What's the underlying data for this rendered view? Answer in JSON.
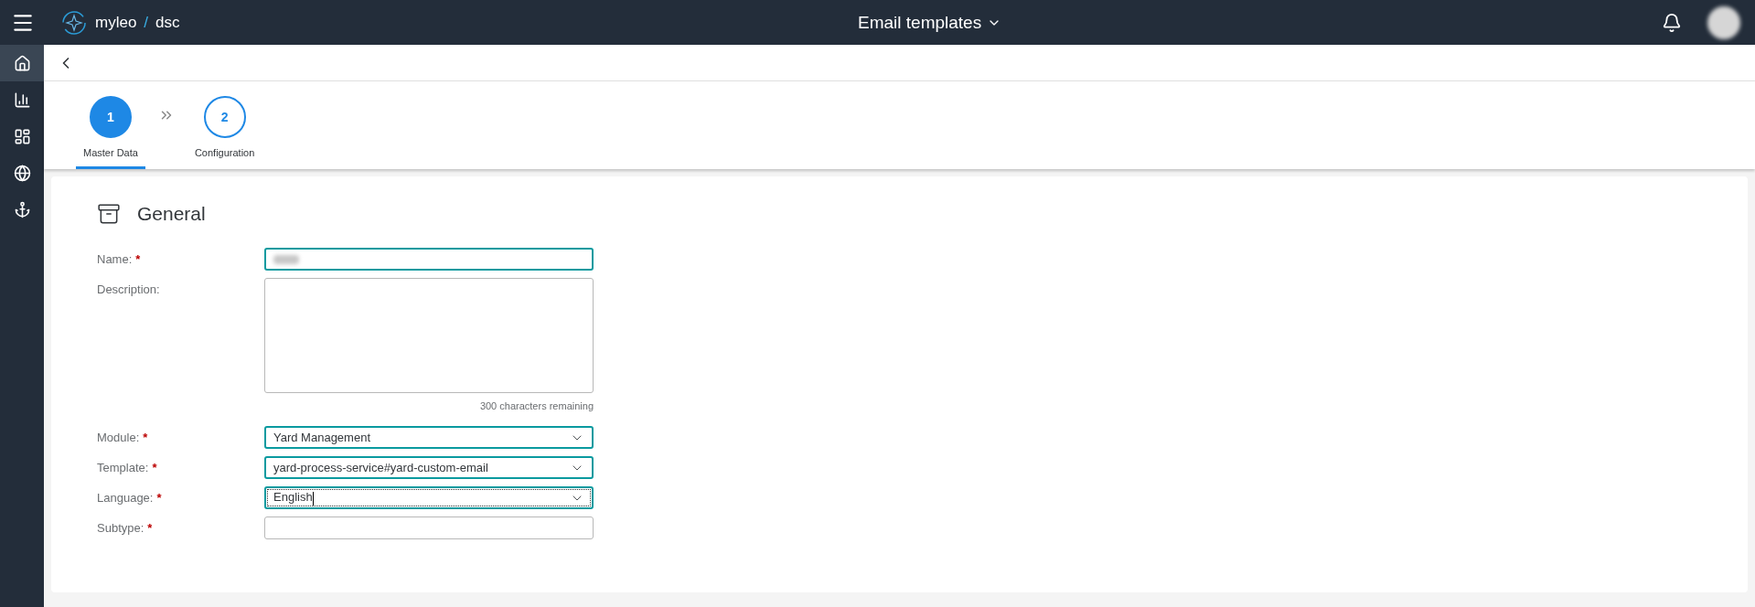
{
  "header": {
    "brand": "myleo",
    "brand_separator": "/",
    "brand_suffix": "dsc",
    "title": "Email templates"
  },
  "sidebar": {
    "items": [
      {
        "selected": true
      },
      {
        "selected": false
      },
      {
        "selected": false
      },
      {
        "selected": false
      },
      {
        "selected": false
      }
    ]
  },
  "wizard": {
    "steps": [
      {
        "number": "1",
        "label": "Master Data",
        "selected": true
      },
      {
        "number": "2",
        "label": "Configuration",
        "selected": false
      }
    ]
  },
  "section": {
    "title": "General"
  },
  "fields": [
    {
      "label": "Name:",
      "required_mark": "*",
      "kind": "input",
      "highlighted": true,
      "focused": false
    },
    {
      "label": "Description:",
      "kind": "textarea",
      "highlighted": false,
      "focused": false,
      "counter": "300 characters remaining"
    },
    {
      "label": "Module:",
      "required_mark": "*",
      "kind": "select",
      "value": "Yard Management",
      "highlighted": true,
      "focused": false
    },
    {
      "label": "Template:",
      "required_mark": "*",
      "kind": "select",
      "value": "yard-process-service#yard-custom-email",
      "highlighted": true,
      "focused": false
    },
    {
      "label": "Language:",
      "required_mark": "*",
      "kind": "select",
      "value": "English",
      "highlighted": true,
      "focused": true
    },
    {
      "label": "Subtype:",
      "required_mark": "*",
      "kind": "input",
      "highlighted": false,
      "focused": false
    }
  ]
}
